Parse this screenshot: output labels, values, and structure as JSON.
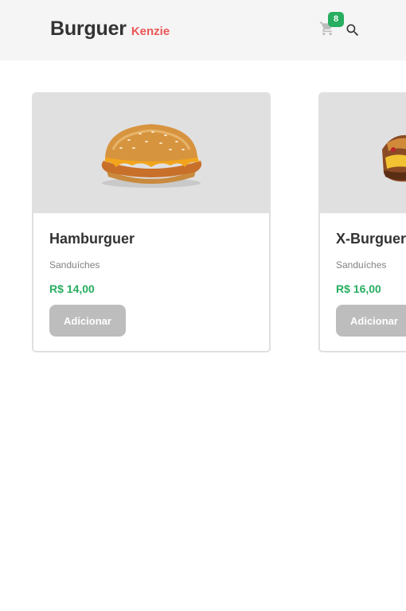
{
  "header": {
    "brand_main": "Burguer",
    "brand_sub": "Kenzie",
    "cart_count": "8",
    "cart_icon": "cart-icon",
    "search_icon": "search-icon"
  },
  "products": [
    {
      "name": "Hamburguer",
      "category": "Sanduíches",
      "price": "R$ 14,00",
      "button": "Adicionar",
      "image": "hamburger-image"
    },
    {
      "name": "X-Burguer",
      "category": "Sanduíches",
      "price": "R$ 16,00",
      "button": "Adicionar",
      "image": "x-burger-image"
    }
  ],
  "colors": {
    "brand": "#333333",
    "accent": "#eb5757",
    "price": "#27ae60",
    "badge": "#27ae60",
    "button_disabled": "#bdbdbd",
    "header_bg": "#f5f5f5",
    "card_image_bg": "#e0e0e0"
  }
}
